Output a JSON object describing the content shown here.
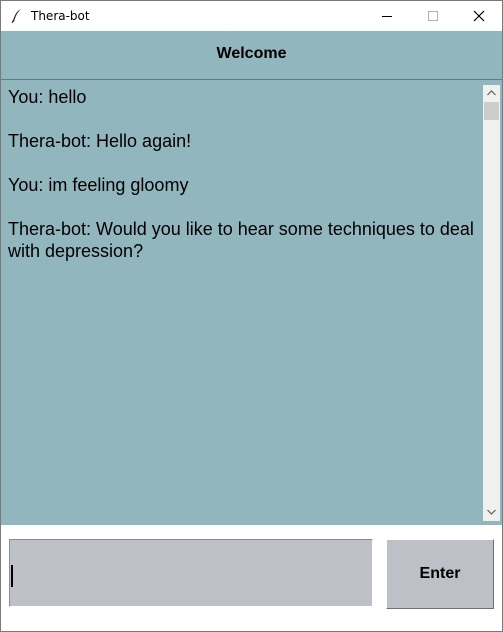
{
  "window": {
    "title": "Thera-bot",
    "icon": "feather-icon"
  },
  "header": {
    "title": "Welcome",
    "background": "#91b6bd"
  },
  "chat": {
    "messages": [
      "You: hello",
      "Thera-bot: Hello again!",
      "You: im feeling gloomy",
      "Thera-bot: Would you like to hear some techniques to deal with depression?"
    ],
    "background": "#91b6bd"
  },
  "input": {
    "value": ""
  },
  "enter_button": {
    "label": "Enter"
  }
}
